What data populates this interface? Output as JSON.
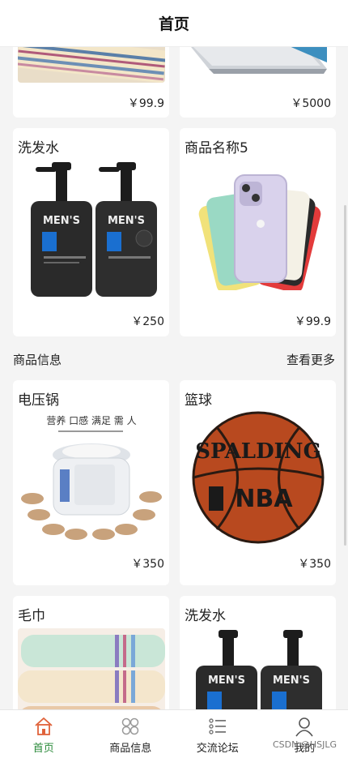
{
  "header": {
    "title": "首页"
  },
  "top_cards": [
    {
      "name": "",
      "price": "￥99.9",
      "image": "towel-image"
    },
    {
      "name": "",
      "price": "￥5000",
      "image": "laptop-image"
    }
  ],
  "recommend": [
    {
      "name": "洗发水",
      "price": "￥250",
      "image": "shampoo-image"
    },
    {
      "name": "商品名称5",
      "price": "￥99.9",
      "image": "phone-image"
    }
  ],
  "section": {
    "title": "商品信息",
    "more": "查看更多"
  },
  "products": [
    {
      "name": "电压锅",
      "price": "￥350",
      "image": "rice-cooker-image"
    },
    {
      "name": "篮球",
      "price": "￥350",
      "image": "basketball-image"
    },
    {
      "name": "毛巾",
      "price": "",
      "image": "towel-image"
    },
    {
      "name": "洗发水",
      "price": "",
      "image": "shampoo-image"
    }
  ],
  "image_text": {
    "men": "MEN'S",
    "cooker_banner": "营养 口感 满足 需 人",
    "ball_brand": "SPALDING",
    "ball_league": "NBA"
  },
  "tabs": [
    {
      "label": "首页",
      "icon": "home-icon",
      "active": true
    },
    {
      "label": "商品信息",
      "icon": "grid-icon",
      "active": false
    },
    {
      "label": "交流论坛",
      "icon": "list-icon",
      "active": false
    },
    {
      "label": "我的",
      "icon": "user-icon",
      "active": false
    }
  ],
  "watermark": "CSDN @HSJLG",
  "colors": {
    "active": "#2a8a3a",
    "background": "#f4f4f4"
  }
}
